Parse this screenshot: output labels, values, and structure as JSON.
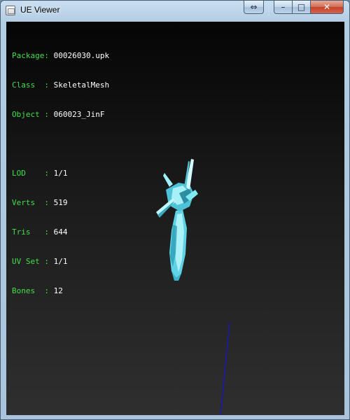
{
  "window": {
    "title": "UE Viewer",
    "buttons": {
      "restore_size": "⇔",
      "minimize": "–",
      "maximize": "□",
      "close": "✕"
    }
  },
  "info": {
    "package_label": "Package:",
    "package_value": "00026030.upk",
    "class_label": "Class  :",
    "class_value": "SkeletalMesh",
    "object_label": "Object :",
    "object_value": "060023_JinF",
    "lod_label": "LOD    :",
    "lod_value": "1/1",
    "verts_label": "Verts  :",
    "verts_value": "519",
    "tris_label": "Tris   :",
    "tris_value": "644",
    "uvset_label": "UV Set :",
    "uvset_value": "1/1",
    "bones_label": "Bones  :",
    "bones_value": "12"
  },
  "colors": {
    "label": "#3fe04a",
    "value": "#ffffff",
    "mesh": "#7fe9f4",
    "axis_line": "#1a1aaa"
  }
}
